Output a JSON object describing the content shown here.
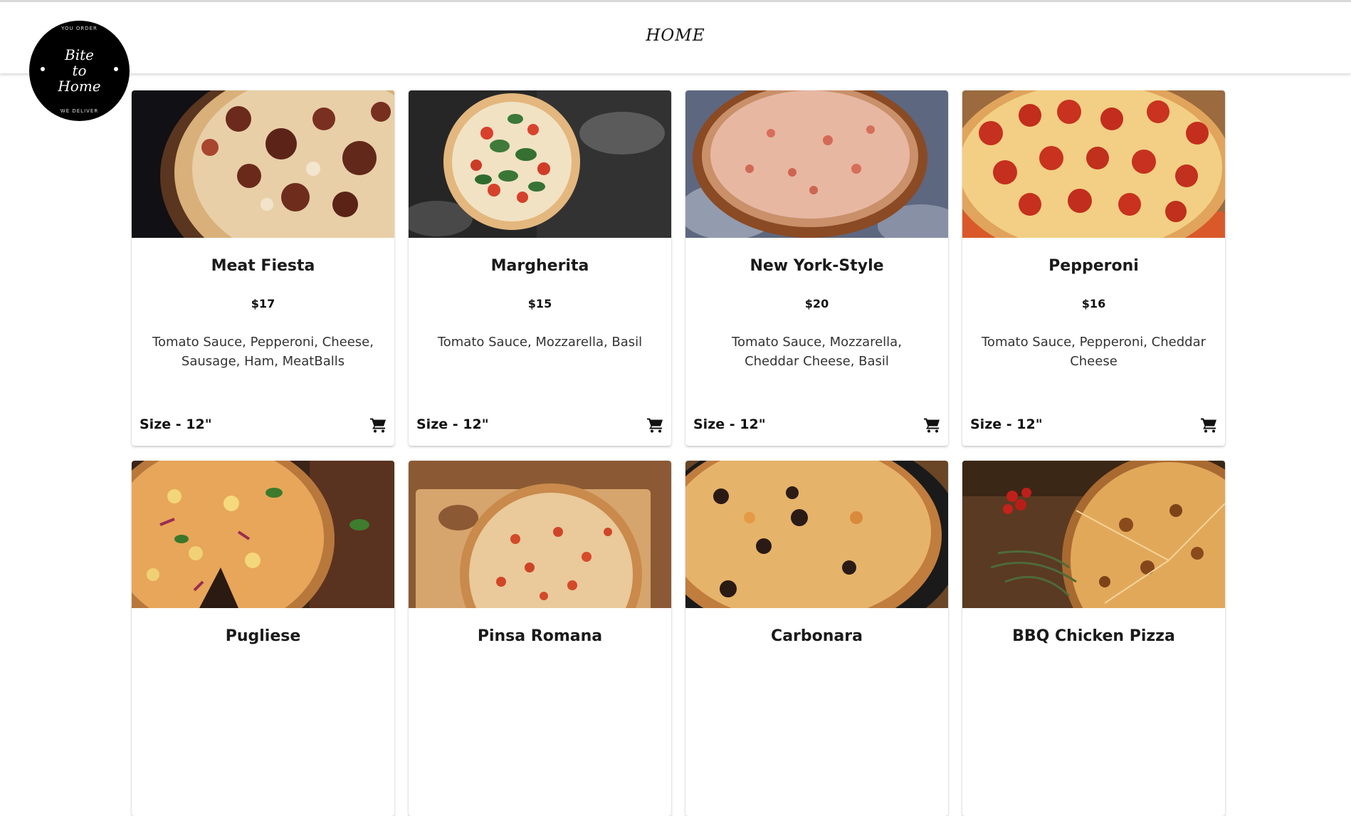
{
  "brand": {
    "top_text": "YOU ORDER",
    "wordmark": [
      "Bite",
      "to",
      "Home"
    ],
    "bottom_text": "WE DELIVER"
  },
  "nav": {
    "home": "HOME"
  },
  "colors": {
    "accent": "#000000",
    "background": "#ffffff"
  },
  "products": [
    {
      "name": "Meat Fiesta",
      "price": "$17",
      "ingredients": "Tomato Sauce, Pepperoni, Cheese, Sausage, Ham, MeatBalls",
      "size": "Size - 12\"",
      "cart_icon": "cart-icon"
    },
    {
      "name": "Margherita",
      "price": "$15",
      "ingredients": "Tomato Sauce, Mozzarella, Basil",
      "size": "Size - 12\"",
      "cart_icon": "cart-icon"
    },
    {
      "name": "New York-Style",
      "price": "$20",
      "ingredients": "Tomato Sauce, Mozzarella, Cheddar Cheese, Basil",
      "size": "Size - 12\"",
      "cart_icon": "cart-icon"
    },
    {
      "name": "Pepperoni",
      "price": "$16",
      "ingredients": "Tomato Sauce, Pepperoni, Cheddar Cheese",
      "size": "Size - 12\"",
      "cart_icon": "cart-icon"
    },
    {
      "name": "Pugliese"
    },
    {
      "name": "Pinsa Romana"
    },
    {
      "name": "Carbonara"
    },
    {
      "name": "BBQ Chicken Pizza"
    }
  ]
}
